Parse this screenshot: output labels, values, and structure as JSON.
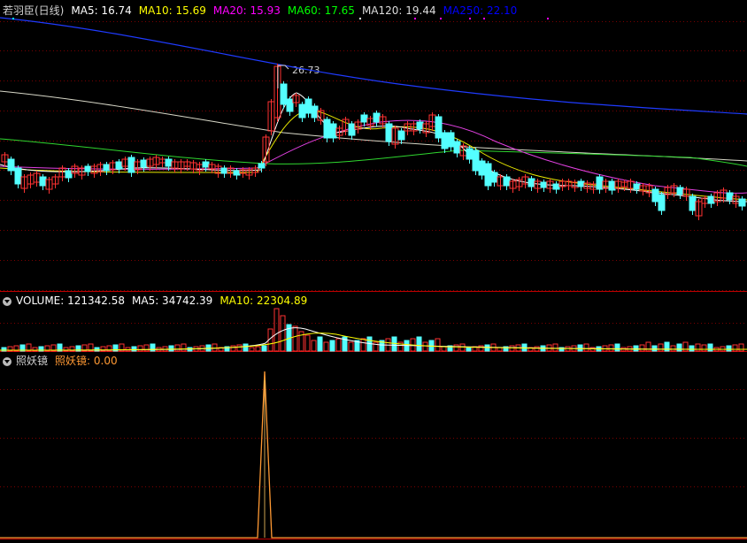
{
  "main": {
    "title": "若羽臣(日线)",
    "ma": [
      {
        "label": "MA5: 16.74",
        "color": "#ffffff"
      },
      {
        "label": "MA10: 15.69",
        "color": "#ffff00"
      },
      {
        "label": "MA20: 15.93",
        "color": "#ff00ff"
      },
      {
        "label": "MA60: 17.65",
        "color": "#00ff00"
      },
      {
        "label": "MA120: 19.44",
        "color": "#dddddd"
      },
      {
        "label": "MA250: 22.10",
        "color": "#0000ff"
      }
    ],
    "high_marker": "26.73"
  },
  "volume": {
    "label": "VOLUME: 121342.58",
    "ma5": "MA5: 34742.39",
    "ma10": "MA10: 22304.89"
  },
  "indicator": {
    "name": "照妖镜",
    "value_label": "照妖镜: 0.00"
  },
  "colors": {
    "up": "#ff3232",
    "down": "#54ffff",
    "grid": "#7a0000",
    "border": "#c00000",
    "ma250": "#1f3bff",
    "ma120": "#d8d8c8",
    "ma60": "#2fd62f",
    "ma20": "#e040e0",
    "ma10": "#e8e800",
    "ma5": "#ffffff",
    "indicator_line": "#ff9933"
  }
}
